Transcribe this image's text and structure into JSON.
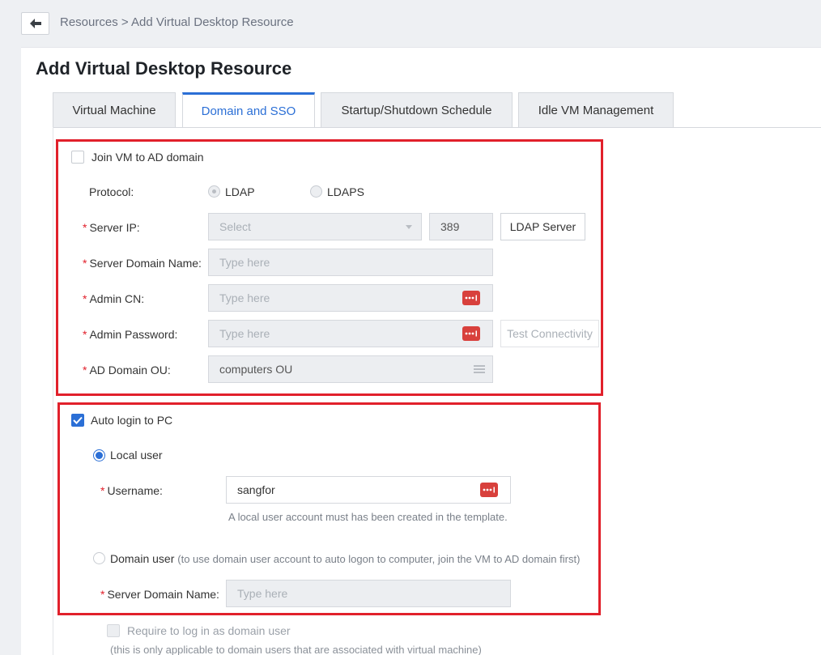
{
  "breadcrumb": {
    "root": "Resources",
    "separator": ">",
    "current": "Add Virtual Desktop Resource"
  },
  "page_title": "Add Virtual Desktop Resource",
  "tabs": [
    {
      "label": "Virtual Machine"
    },
    {
      "label": "Domain and SSO"
    },
    {
      "label": "Startup/Shutdown Schedule"
    },
    {
      "label": "Idle VM Management"
    }
  ],
  "ad": {
    "join_label": "Join VM to AD domain",
    "join_checked": false,
    "protocol_label": "Protocol:",
    "protocol_options": [
      "LDAP",
      "LDAPS"
    ],
    "server_ip_label": "Server IP:",
    "server_ip_placeholder": "Select",
    "port_value": "389",
    "ldap_server_button": "LDAP Server",
    "server_domain_label": "Server Domain Name:",
    "server_domain_placeholder": "Type here",
    "admin_cn_label": "Admin CN:",
    "admin_cn_placeholder": "Type here",
    "admin_password_label": "Admin Password:",
    "admin_password_placeholder": "Type here",
    "test_button": "Test Connectivity",
    "ou_label": "AD Domain OU:",
    "ou_value": "computers OU",
    "required_mark": "*"
  },
  "sso": {
    "auto_login_label": "Auto login to PC",
    "auto_login_checked": true,
    "local_user_label": "Local user",
    "username_label": "Username:",
    "username_value": "sangfor",
    "username_hint": "A local user account must has been created in the template.",
    "domain_user_label": "Domain user",
    "domain_user_note": "(to use domain user account to auto logon to computer, join the VM to AD domain first)",
    "server_domain_label": "Server Domain Name:",
    "server_domain_placeholder": "Type here",
    "require_label": "Require to log in as domain user",
    "require_note": "(this is only applicable to domain users that are associated with virtual machine)"
  },
  "colors": {
    "accent": "#2b6fd6",
    "highlight_box": "#e1202b",
    "password_icon": "#d8403c"
  }
}
